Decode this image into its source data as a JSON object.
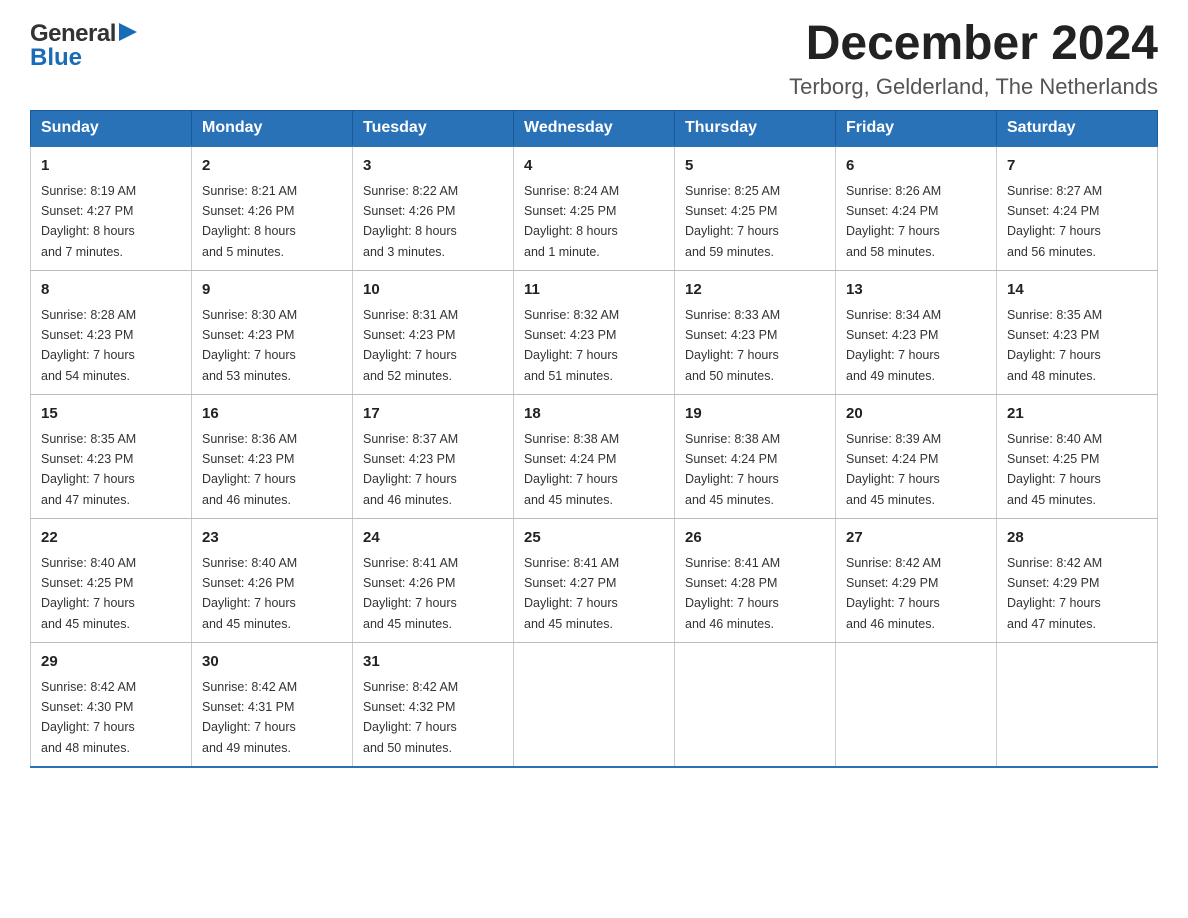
{
  "header": {
    "logo": {
      "general": "General",
      "blue": "Blue",
      "arrow_color": "#1a6cb5"
    },
    "title": "December 2024",
    "subtitle": "Terborg, Gelderland, The Netherlands"
  },
  "calendar": {
    "days_of_week": [
      "Sunday",
      "Monday",
      "Tuesday",
      "Wednesday",
      "Thursday",
      "Friday",
      "Saturday"
    ],
    "weeks": [
      [
        {
          "day": "1",
          "sunrise": "Sunrise: 8:19 AM",
          "sunset": "Sunset: 4:27 PM",
          "daylight": "Daylight: 8 hours",
          "daylight2": "and 7 minutes."
        },
        {
          "day": "2",
          "sunrise": "Sunrise: 8:21 AM",
          "sunset": "Sunset: 4:26 PM",
          "daylight": "Daylight: 8 hours",
          "daylight2": "and 5 minutes."
        },
        {
          "day": "3",
          "sunrise": "Sunrise: 8:22 AM",
          "sunset": "Sunset: 4:26 PM",
          "daylight": "Daylight: 8 hours",
          "daylight2": "and 3 minutes."
        },
        {
          "day": "4",
          "sunrise": "Sunrise: 8:24 AM",
          "sunset": "Sunset: 4:25 PM",
          "daylight": "Daylight: 8 hours",
          "daylight2": "and 1 minute."
        },
        {
          "day": "5",
          "sunrise": "Sunrise: 8:25 AM",
          "sunset": "Sunset: 4:25 PM",
          "daylight": "Daylight: 7 hours",
          "daylight2": "and 59 minutes."
        },
        {
          "day": "6",
          "sunrise": "Sunrise: 8:26 AM",
          "sunset": "Sunset: 4:24 PM",
          "daylight": "Daylight: 7 hours",
          "daylight2": "and 58 minutes."
        },
        {
          "day": "7",
          "sunrise": "Sunrise: 8:27 AM",
          "sunset": "Sunset: 4:24 PM",
          "daylight": "Daylight: 7 hours",
          "daylight2": "and 56 minutes."
        }
      ],
      [
        {
          "day": "8",
          "sunrise": "Sunrise: 8:28 AM",
          "sunset": "Sunset: 4:23 PM",
          "daylight": "Daylight: 7 hours",
          "daylight2": "and 54 minutes."
        },
        {
          "day": "9",
          "sunrise": "Sunrise: 8:30 AM",
          "sunset": "Sunset: 4:23 PM",
          "daylight": "Daylight: 7 hours",
          "daylight2": "and 53 minutes."
        },
        {
          "day": "10",
          "sunrise": "Sunrise: 8:31 AM",
          "sunset": "Sunset: 4:23 PM",
          "daylight": "Daylight: 7 hours",
          "daylight2": "and 52 minutes."
        },
        {
          "day": "11",
          "sunrise": "Sunrise: 8:32 AM",
          "sunset": "Sunset: 4:23 PM",
          "daylight": "Daylight: 7 hours",
          "daylight2": "and 51 minutes."
        },
        {
          "day": "12",
          "sunrise": "Sunrise: 8:33 AM",
          "sunset": "Sunset: 4:23 PM",
          "daylight": "Daylight: 7 hours",
          "daylight2": "and 50 minutes."
        },
        {
          "day": "13",
          "sunrise": "Sunrise: 8:34 AM",
          "sunset": "Sunset: 4:23 PM",
          "daylight": "Daylight: 7 hours",
          "daylight2": "and 49 minutes."
        },
        {
          "day": "14",
          "sunrise": "Sunrise: 8:35 AM",
          "sunset": "Sunset: 4:23 PM",
          "daylight": "Daylight: 7 hours",
          "daylight2": "and 48 minutes."
        }
      ],
      [
        {
          "day": "15",
          "sunrise": "Sunrise: 8:35 AM",
          "sunset": "Sunset: 4:23 PM",
          "daylight": "Daylight: 7 hours",
          "daylight2": "and 47 minutes."
        },
        {
          "day": "16",
          "sunrise": "Sunrise: 8:36 AM",
          "sunset": "Sunset: 4:23 PM",
          "daylight": "Daylight: 7 hours",
          "daylight2": "and 46 minutes."
        },
        {
          "day": "17",
          "sunrise": "Sunrise: 8:37 AM",
          "sunset": "Sunset: 4:23 PM",
          "daylight": "Daylight: 7 hours",
          "daylight2": "and 46 minutes."
        },
        {
          "day": "18",
          "sunrise": "Sunrise: 8:38 AM",
          "sunset": "Sunset: 4:24 PM",
          "daylight": "Daylight: 7 hours",
          "daylight2": "and 45 minutes."
        },
        {
          "day": "19",
          "sunrise": "Sunrise: 8:38 AM",
          "sunset": "Sunset: 4:24 PM",
          "daylight": "Daylight: 7 hours",
          "daylight2": "and 45 minutes."
        },
        {
          "day": "20",
          "sunrise": "Sunrise: 8:39 AM",
          "sunset": "Sunset: 4:24 PM",
          "daylight": "Daylight: 7 hours",
          "daylight2": "and 45 minutes."
        },
        {
          "day": "21",
          "sunrise": "Sunrise: 8:40 AM",
          "sunset": "Sunset: 4:25 PM",
          "daylight": "Daylight: 7 hours",
          "daylight2": "and 45 minutes."
        }
      ],
      [
        {
          "day": "22",
          "sunrise": "Sunrise: 8:40 AM",
          "sunset": "Sunset: 4:25 PM",
          "daylight": "Daylight: 7 hours",
          "daylight2": "and 45 minutes."
        },
        {
          "day": "23",
          "sunrise": "Sunrise: 8:40 AM",
          "sunset": "Sunset: 4:26 PM",
          "daylight": "Daylight: 7 hours",
          "daylight2": "and 45 minutes."
        },
        {
          "day": "24",
          "sunrise": "Sunrise: 8:41 AM",
          "sunset": "Sunset: 4:26 PM",
          "daylight": "Daylight: 7 hours",
          "daylight2": "and 45 minutes."
        },
        {
          "day": "25",
          "sunrise": "Sunrise: 8:41 AM",
          "sunset": "Sunset: 4:27 PM",
          "daylight": "Daylight: 7 hours",
          "daylight2": "and 45 minutes."
        },
        {
          "day": "26",
          "sunrise": "Sunrise: 8:41 AM",
          "sunset": "Sunset: 4:28 PM",
          "daylight": "Daylight: 7 hours",
          "daylight2": "and 46 minutes."
        },
        {
          "day": "27",
          "sunrise": "Sunrise: 8:42 AM",
          "sunset": "Sunset: 4:29 PM",
          "daylight": "Daylight: 7 hours",
          "daylight2": "and 46 minutes."
        },
        {
          "day": "28",
          "sunrise": "Sunrise: 8:42 AM",
          "sunset": "Sunset: 4:29 PM",
          "daylight": "Daylight: 7 hours",
          "daylight2": "and 47 minutes."
        }
      ],
      [
        {
          "day": "29",
          "sunrise": "Sunrise: 8:42 AM",
          "sunset": "Sunset: 4:30 PM",
          "daylight": "Daylight: 7 hours",
          "daylight2": "and 48 minutes."
        },
        {
          "day": "30",
          "sunrise": "Sunrise: 8:42 AM",
          "sunset": "Sunset: 4:31 PM",
          "daylight": "Daylight: 7 hours",
          "daylight2": "and 49 minutes."
        },
        {
          "day": "31",
          "sunrise": "Sunrise: 8:42 AM",
          "sunset": "Sunset: 4:32 PM",
          "daylight": "Daylight: 7 hours",
          "daylight2": "and 50 minutes."
        },
        null,
        null,
        null,
        null
      ]
    ]
  }
}
